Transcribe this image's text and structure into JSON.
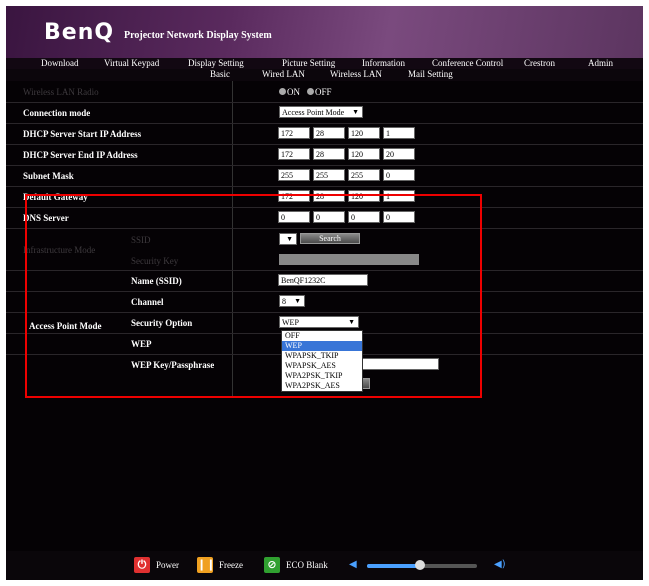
{
  "header": {
    "logo": "BenQ",
    "subtitle": "Projector Network Display System"
  },
  "nav": [
    "Download",
    "Virtual Keypad",
    "Display Setting",
    "Picture Setting",
    "Information",
    "Conference Control",
    "Crestron",
    "Admin"
  ],
  "subnav": [
    "Basic",
    "Wired LAN",
    "Wireless LAN",
    "Mail Setting"
  ],
  "form": {
    "wireless_radio": {
      "label": "Wireless LAN Radio",
      "on": "ON",
      "off": "OFF"
    },
    "connection_mode": {
      "label": "Connection mode",
      "value": "Access Point Mode"
    },
    "dhcp_start": {
      "label": "DHCP Server Start IP Address",
      "octets": [
        "172",
        "28",
        "120",
        "1"
      ]
    },
    "dhcp_end": {
      "label": "DHCP Server End IP Address",
      "octets": [
        "172",
        "28",
        "120",
        "20"
      ]
    },
    "subnet": {
      "label": "Subnet Mask",
      "octets": [
        "255",
        "255",
        "255",
        "0"
      ]
    },
    "gateway": {
      "label": "Default Gateway",
      "octets": [
        "172",
        "28",
        "120",
        "1"
      ]
    },
    "dns": {
      "label": "DNS Server",
      "octets": [
        "0",
        "0",
        "0",
        "0"
      ]
    },
    "infra": {
      "label": "Infrastructure Mode",
      "ssid": "SSID",
      "security_key": "Security Key",
      "search": "Search"
    },
    "ap": {
      "label": "Access Point Mode",
      "name_label": "Name (SSID)",
      "name_value": "BenQF1232C",
      "channel_label": "Channel",
      "channel_value": "8",
      "security_label": "Security Option",
      "security_value": "WEP",
      "wep_label": "WEP",
      "wep_key_label": "WEP Key/Passphrase",
      "security_options": [
        "OFF",
        "WEP",
        "WPAPSK_TKIP",
        "WPAPSK_AES",
        "WPA2PSK_TKIP",
        "WPA2PSK_AES"
      ],
      "highlighted": "WEP"
    }
  },
  "footer": {
    "power": "Power",
    "freeze": "Freeze",
    "eco": "ECO Blank",
    "volume": 0.48
  },
  "colors": {
    "highlight": "#3875d7",
    "callout": "#e00000",
    "power": "#e03030",
    "freeze": "#f0a020",
    "eco": "#30a030"
  }
}
